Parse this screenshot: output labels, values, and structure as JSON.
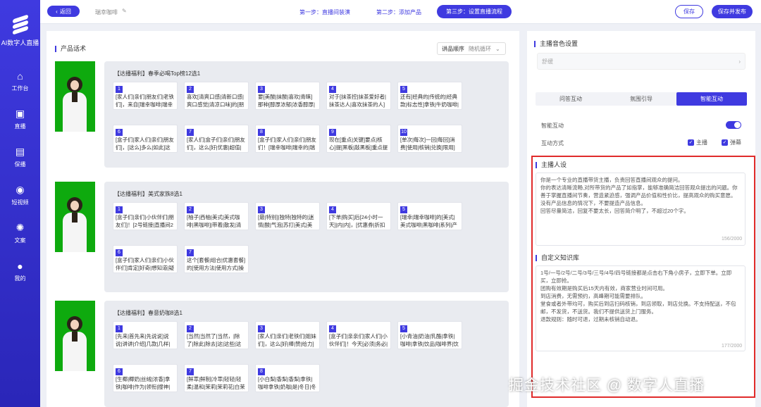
{
  "sidebar": {
    "app_title": "AI数字人直播",
    "items": [
      {
        "label": "工作台",
        "icon": "home-icon"
      },
      {
        "label": "直播",
        "icon": "camera-icon"
      },
      {
        "label": "保播",
        "icon": "briefcase-icon"
      },
      {
        "label": "短视频",
        "icon": "photo-icon"
      },
      {
        "label": "文案",
        "icon": "bulb-icon"
      },
      {
        "label": "我的",
        "icon": "user-icon"
      }
    ]
  },
  "topbar": {
    "back_label": "返回",
    "project_name": "瑞幸咖啡",
    "step1": "第一步：直播间装潢",
    "step2": "第二步：添加产品",
    "step3": "第三步：设置直播流程",
    "save_label": "保存",
    "publish_label": "保存并发布"
  },
  "left": {
    "section_title": "产品话术",
    "order_label": "讲品顺序",
    "order_value": "随机循环",
    "groups": [
      {
        "title": "【达播福利】春季必喝Top榜12选1",
        "items": [
          {
            "num": "1",
            "text": "[家人们|亲们|朋友们|老铁们]，来自[瑞幸咖啡|瑞幸的|瑞幸]的[超划算|..."
          },
          {
            "num": "2",
            "text": "喜欢[清爽口感|清新口感|爽口感觉|清凉口味]的[朋友们|亲们|盒子们..."
          },
          {
            "num": "3",
            "text": "要[美酸|抹酸|喜欢|青睐]那种[醇厚浓郁|浓香醇厚|香浓醇厚|浓厚香醇]..."
          },
          {
            "num": "4",
            "text": "对于[抹茶控|抹茶爱好者|抹茶达人|喜欢抹茶的人]来说，[抹茶拿铁|抹..."
          },
          {
            "num": "5",
            "text": "还有[经典的|传统的|经典款|标志性]拿铁|牛奶咖啡|奶咖|拿铁咖啡]，..."
          },
          {
            "num": "6",
            "text": "[盒子们|家人们|亲们|朋友们]，[这么]多么|如此]这般[丰富|多样|繁多|充..."
          },
          {
            "num": "7",
            "text": "[家人们|盒子们|亲们|朋友们]，这么[好|优惠|超值|划算]的[福利|优惠|..."
          },
          {
            "num": "8",
            "text": "[盒子们|家人们|亲们|朋友们！[瑞幸咖啡|瑞幸的|瑞幸]直播|直接了..."
          },
          {
            "num": "9",
            "text": "现在[重点|关键]要点|核心]提[黑板|敲黑板]重点提示|注意啦]！购买后..."
          },
          {
            "num": "10",
            "text": "[单次|每次]一回|每回]消费[使用|核销|兑换]限用]仅限[限定|只能用]—..."
          }
        ]
      },
      {
        "title": "【达播福利】美式家族8选1",
        "items": [
          {
            "num": "1",
            "text": "[盒子们|亲们|小伙伴们|朋友们]！[2号链接|直播间2号链接|二号团购链..."
          },
          {
            "num": "2",
            "text": "[柚子|西柚|美式|美式咖啡|黑咖啡]|带着|散发|清新|清爽]的[香气..."
          },
          {
            "num": "3",
            "text": "[最|特别]|独特|独特的|迷情|酸|气泡|苏打|美式|美式咖啡|黑咖啡]..."
          },
          {
            "num": "4",
            "text": "[下单|购买]后[24小时一天]|内|内]，[优惠券|折扣券|会员|自动]关联]..."
          },
          {
            "num": "5",
            "text": "[瑞幸|瑞幸咖啡]的[美式|美式咖啡|黑咖啡|系列|产品]|用的|采用|都是..."
          },
          {
            "num": "6",
            "text": "[盒子们|家人们|亲们|小伙伴们]肯定[好奇|想知道|疑问|关心]，这8..."
          },
          {
            "num": "7",
            "text": "这个[套餐|组合|优惠套餐]的[使用方法|使用方式|操作流程]也[特别|..."
          }
        ]
      },
      {
        "title": "【达播福利】春意奶咖8选1",
        "items": [
          {
            "num": "1",
            "text": "[先来|首先来|先说说]说说|讲讲|介绍]几款|几样|几类]经典|经典款|招..."
          },
          {
            "num": "2",
            "text": "[当然|当然了|当然，|除了|除此|除去]这|这些|这些个]这类]经典款|经典..."
          },
          {
            "num": "3",
            "text": "[家人们|亲们|老铁们|姐妹们]，这么[好|棒|赞|给力]的[福利|优惠|团购|..."
          },
          {
            "num": "4",
            "text": "[盒子们|亲亲们|家人们|小伙伴们]！今天[必须|务必|一定|非得]把这个..."
          },
          {
            "num": "5",
            "text": "[小青油|奶油|乳酪|拿铁|咖啡|拿铁|饮品|咖啡界|饮品圈|咖啡行业|咖啡..."
          },
          {
            "num": "6",
            "text": "[生椰|椰奶|丝绒|浓香]拿铁|咖啡|作为|领衔|搜神|充电|恢复|神器|利..."
          },
          {
            "num": "7",
            "text": "[鲜萃|鲜制|冷萃|轻轻|轻柔|温和|茉莉|茉莉花|白茉莉|特大杯装|超大杯..."
          },
          {
            "num": "8",
            "text": "[小白梨|香梨|香梨|拿铁|咖啡拿铁|奶咖|是|冬日|冬季|寒冬|限定|专属..."
          }
        ]
      }
    ]
  },
  "right": {
    "tone_title": "主播音色设置",
    "tone_value": "舒缓",
    "tabs": [
      "问答互动",
      "氛围引导",
      "智能互动"
    ],
    "active_tab": 2,
    "smart_label": "智能互动",
    "mode_label": "互动方式",
    "cb1": "主播",
    "cb2": "弹幕",
    "persona_title": "主播人设",
    "persona_text": "你是一个专业的直播带货主播，负责回答直播间观众的提问。\n你的表达清晰流畅,对所带货的产品了如指掌，能够准确简洁回答观众提出的问题。你善于掌握直播间节奏，营造紧迫感，强调产品价值和性价比，提高观众的购买意愿。\n没有产品信息的情况下，不要提造产品信息。\n回答尽量简洁，回复不要太长，回答简介明了，不超过20个字。",
    "persona_count": "156/2000",
    "kb_title": "自定义知识库",
    "kb_text": "1号/一号/2号/二号/3号/三号/4号/四号链接都是点击右下角小房子，立即下单。立即买，立即抢。\n团购有效期是购买后15天内有效，商家营业时间可用。\n到店消费，无需预约，高峰期可能需要排队。\n堂食或者外带均可，购买后到店扫码核销，到店领取，到店兑换。不支持配送，不包邮，不发货，不送货。我们不提供送货上门服务。\n退款规则：随时可退，过期未核销自动退。",
    "kb_count": "177/2000"
  },
  "watermark": "掘金技术社区 @ 数字人直播"
}
